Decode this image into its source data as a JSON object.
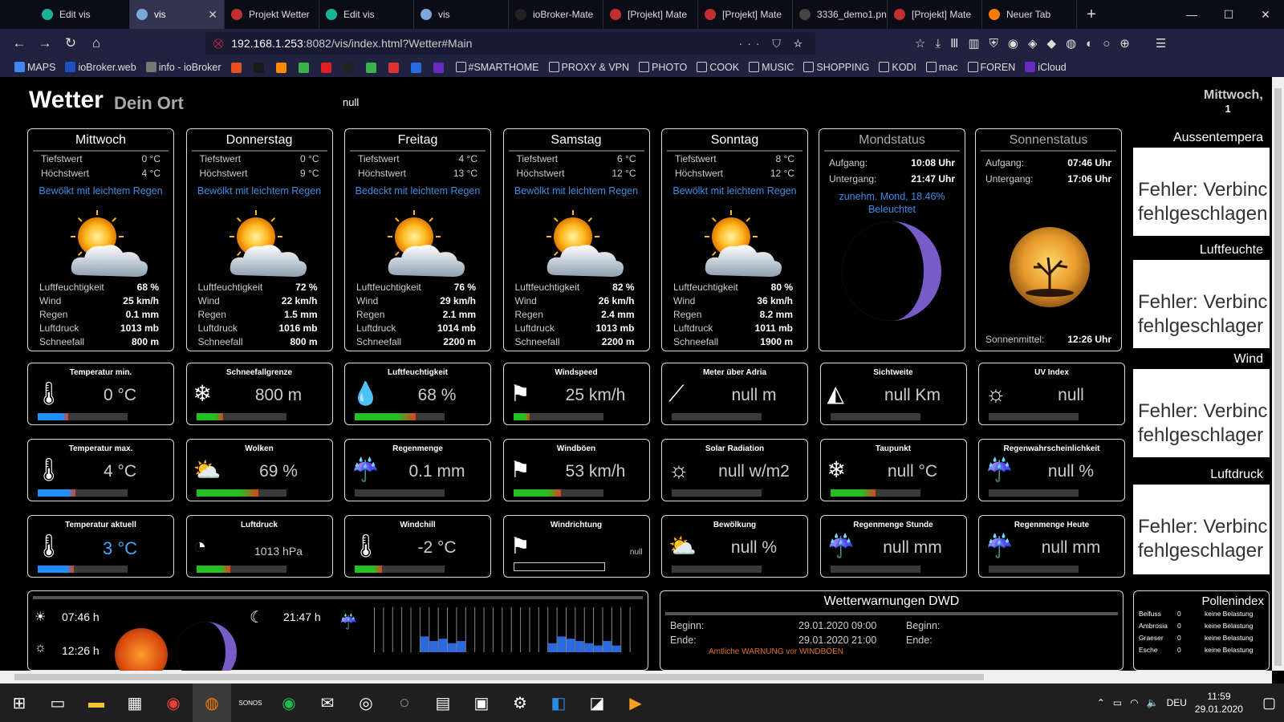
{
  "browser": {
    "tabs": [
      {
        "label": "Edit vis",
        "color": "#1ab39a"
      },
      {
        "label": "vis",
        "color": "#7aa8d8",
        "active": true
      },
      {
        "label": "Projekt Wetter",
        "color": "#c03030"
      },
      {
        "label": "Edit vis",
        "color": "#1ab39a"
      },
      {
        "label": "vis",
        "color": "#7aa8d8"
      },
      {
        "label": "ioBroker-Mate",
        "color": "#222"
      },
      {
        "label": "[Projekt] Mate",
        "color": "#c03030"
      },
      {
        "label": "[Projekt] Mate",
        "color": "#c03030"
      },
      {
        "label": "3336_demo1.png (",
        "color": "#444"
      },
      {
        "label": "[Projekt] Mate",
        "color": "#c03030"
      },
      {
        "label": "Neuer Tab",
        "color": "#ff7a00"
      }
    ],
    "url_host": "192.168.1.253",
    "url_rest": ":8082/vis/index.html?Wetter#Main",
    "url_actions": "··· ⛉ ☆",
    "bookmarks": [
      "MAPS",
      "ioBroker.web",
      "info - ioBroker",
      "#SMARTHOME",
      "PROXY & VPN",
      "PHOTO",
      "COOK",
      "MUSIC",
      "SHOPPING",
      "KODI",
      "mac",
      "FOREN",
      "iCloud"
    ],
    "bookmark_icon_labels": {
      "w": "W",
      "y": "Y"
    }
  },
  "header": {
    "title": "Wetter",
    "subtitle": "Dein Ort",
    "null_text": "null",
    "date": "Mittwoch,",
    "date2": "1"
  },
  "days": [
    {
      "name": "Mittwoch",
      "min_label": "Tiefstwert",
      "min": "0 °C",
      "max_label": "Höchstwert",
      "max": "4 °C",
      "desc": "Bewölkt mit leichtem Regen",
      "hum": "68 %",
      "wind": "25 km/h",
      "rain": "0.1 mm",
      "press": "1013 mb",
      "snow": "800 m"
    },
    {
      "name": "Donnerstag",
      "min_label": "Tiefstwert",
      "min": "0 °C",
      "max_label": "Höchstwert",
      "max": "9 °C",
      "desc": "Bewölkt mit leichtem Regen",
      "hum": "72 %",
      "wind": "22 km/h",
      "rain": "1.5 mm",
      "press": "1016 mb",
      "snow": "800 m"
    },
    {
      "name": "Freitag",
      "min_label": "Tiefstwert",
      "min": "4 °C",
      "max_label": "Höchstwert",
      "max": "13 °C",
      "desc": "Bedeckt mit leichtem Regen",
      "hum": "76 %",
      "wind": "29 km/h",
      "rain": "2.1 mm",
      "press": "1014 mb",
      "snow": "2200 m"
    },
    {
      "name": "Samstag",
      "min_label": "Tiefstwert",
      "min": "6 °C",
      "max_label": "Höchstwert",
      "max": "12 °C",
      "desc": "Bewölkt mit leichtem Regen",
      "hum": "82 %",
      "wind": "26 km/h",
      "rain": "2.4 mm",
      "press": "1013 mb",
      "snow": "2200 m"
    },
    {
      "name": "Sonntag",
      "min_label": "Tiefstwert",
      "min": "8 °C",
      "max_label": "Höchstwert",
      "max": "12 °C",
      "desc": "Bewölkt mit leichtem Regen",
      "hum": "80 %",
      "wind": "36 km/h",
      "rain": "8.2 mm",
      "press": "1011 mb",
      "snow": "1900 m"
    }
  ],
  "detail_labels": {
    "hum": "Luftfeuchtigkeit",
    "wind": "Wind",
    "rain": "Regen",
    "press": "Luftdruck",
    "snow": "Schneefall"
  },
  "moon": {
    "title": "Mondstatus",
    "rise_label": "Aufgang:",
    "rise": "10:08 Uhr",
    "set_label": "Untergang:",
    "set": "21:47 Uhr",
    "phase": "zunehm. Mond, 18.46%",
    "phase2": "Beleuchtet",
    "color": "#7a5cc8"
  },
  "sun": {
    "title": "Sonnenstatus",
    "rise_label": "Aufgang:",
    "rise": "07:46 Uhr",
    "set_label": "Untergang:",
    "set": "17:06 Uhr",
    "noon_label": "Sonnenmittel:",
    "noon": "12:26 Uhr"
  },
  "tiles": [
    {
      "title": "Temperatur min.",
      "value": "0 °C",
      "icon": "thermometer-min-icon",
      "glyph": "🌡",
      "bar": "temp",
      "fill": 0.34
    },
    {
      "title": "Schneefallgrenze",
      "value": "800 m",
      "icon": "snowflake-icon",
      "glyph": "❄",
      "bar": "green",
      "fill": 0.3
    },
    {
      "title": "Luftfeuchtigkeit",
      "value": "68 %",
      "icon": "humidity-icon",
      "glyph": "💧",
      "bar": "redgreen",
      "fill": 0.68
    },
    {
      "title": "Windspeed",
      "value": "25 km/h",
      "icon": "windsock-icon",
      "glyph": "⚑",
      "bar": "green",
      "fill": 0.18
    },
    {
      "title": "Meter über Adria",
      "value": "null m",
      "icon": "altitude-icon",
      "glyph": "⟋",
      "bar": "none",
      "fill": 0
    },
    {
      "title": "Sichtweite",
      "value": "null Km",
      "icon": "visibility-icon",
      "glyph": "◭",
      "bar": "none",
      "fill": 0
    },
    {
      "title": "UV Index",
      "value": "null",
      "icon": "uv-sun-icon",
      "glyph": "☼",
      "bar": "none",
      "fill": 0
    },
    {
      "title": "Temperatur max.",
      "value": "4 °C",
      "icon": "thermometer-max-icon",
      "glyph": "🌡",
      "bar": "temp",
      "fill": 0.42
    },
    {
      "title": "Wolken",
      "value": "69 %",
      "icon": "cloud-sun-icon",
      "glyph": "⛅",
      "bar": "redgreen",
      "fill": 0.69
    },
    {
      "title": "Regenmenge",
      "value": "0.1 mm",
      "icon": "rain-cloud-icon",
      "glyph": "☔",
      "bar": "none",
      "fill": 0
    },
    {
      "title": "Windböen",
      "value": "53 km/h",
      "icon": "gust-windsock-icon",
      "glyph": "⚑",
      "bar": "redgreen",
      "fill": 0.53
    },
    {
      "title": "Solar Radiation",
      "value": "null w/m2",
      "icon": "solar-icon",
      "glyph": "☼",
      "bar": "none",
      "fill": 0
    },
    {
      "title": "Taupunkt",
      "value": "null °C",
      "icon": "dewpoint-icon",
      "glyph": "❄",
      "bar": "redgreen",
      "fill": 0.5
    },
    {
      "title": "Regenwahrscheinlichkeit",
      "value": "null %",
      "icon": "rain-probability-icon",
      "glyph": "☔",
      "bar": "none",
      "fill": 0
    },
    {
      "title": "Temperatur aktuell",
      "value": "3 °C",
      "icon": "thermometer-icon",
      "glyph": "🌡",
      "bar": "temp",
      "fill": 0.4,
      "blue": true
    },
    {
      "title": "Luftdruck",
      "value": "1013 hPa",
      "icon": "barometer-icon",
      "glyph": "◔",
      "bar": "green",
      "fill": 0.38,
      "small": true
    },
    {
      "title": "Windchill",
      "value": "-2 °C",
      "icon": "windchill-icon",
      "glyph": "🌡",
      "bar": "green",
      "fill": 0.3
    },
    {
      "title": "Windrichtung",
      "value": "null",
      "icon": "wind-direction-icon",
      "glyph": "⚑",
      "bar": "outline",
      "fill": 0,
      "tiny": true
    },
    {
      "title": "Bewölkung",
      "value": "null %",
      "icon": "cloud-icon",
      "glyph": "⛅",
      "bar": "none",
      "fill": 0
    },
    {
      "title": "Regenmenge Stunde",
      "value": "null mm",
      "icon": "rain-hour-icon",
      "glyph": "☔",
      "bar": "none",
      "fill": 0
    },
    {
      "title": "Regenmenge Heute",
      "value": "null mm",
      "icon": "rain-today-icon",
      "glyph": "☔",
      "bar": "none",
      "fill": 0
    }
  ],
  "right": [
    {
      "title": "Aussentempera",
      "err1": "Fehler: Verbinc",
      "err2": "fehlgeschlagen"
    },
    {
      "title": "Luftfeuchte",
      "err1": "Fehler: Verbinc",
      "err2": "fehlgeschlager"
    },
    {
      "title": "Wind",
      "err1": "Fehler: Verbinc",
      "err2": "fehlgeschlager"
    },
    {
      "title": "Luftdruck",
      "err1": "Fehler: Verbinc",
      "err2": "fehlgeschlager"
    }
  ],
  "bottom": {
    "sunrise": "07:46 h",
    "noon": "12:26 h",
    "moonset": "21:47 h",
    "rain_bars": [
      0,
      0,
      0,
      0,
      0,
      0.35,
      0.25,
      0.3,
      0.2,
      0.25,
      0,
      0,
      0,
      0,
      0,
      0,
      0,
      0,
      0,
      0.2,
      0.35,
      0.3,
      0.25,
      0.2,
      0.15,
      0.25,
      0.15,
      0,
      0
    ]
  },
  "warn": {
    "title": "Wetterwarnungen DWD",
    "begin_label": "Beginn:",
    "begin": "29.01.2020 09:00",
    "end_label": "Ende:",
    "end": "29.01.2020 21:00",
    "begin2_label": "Beginn:",
    "end2_label": "Ende:",
    "text": "Amtliche WARNUNG vor WINDBÖEN"
  },
  "pollen": {
    "title": "Pollenindex",
    "rows": [
      [
        "Beifuss",
        "0",
        "keine Belastung"
      ],
      [
        "Ambrosia",
        "0",
        "keine Belastung"
      ],
      [
        "Graeser",
        "0",
        "keine Belastung"
      ],
      [
        "Esche",
        "0",
        "keine Belastung"
      ]
    ]
  },
  "taskbar": {
    "lang": "DEU",
    "time": "11:59",
    "date": "29.01.2020",
    "sonos": "SONOS"
  }
}
